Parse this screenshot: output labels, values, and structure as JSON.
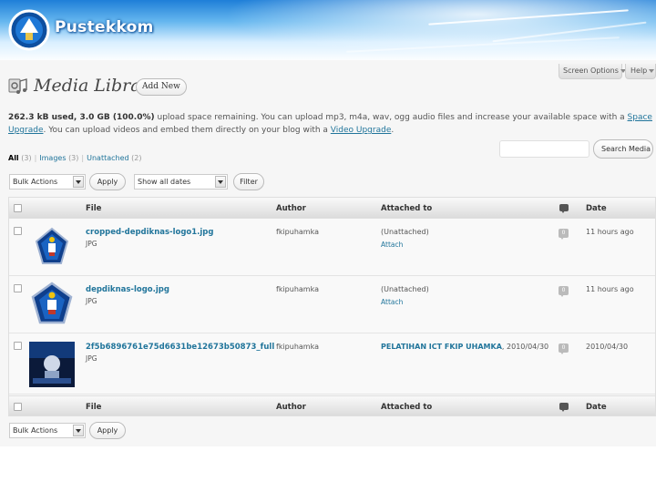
{
  "banner": {
    "title": "Pustekkom"
  },
  "tabs": {
    "screen_options": "Screen Options",
    "help": "Help"
  },
  "page": {
    "title": "Media Library",
    "add_new": "Add New"
  },
  "space_info": {
    "used": "262.3 kB used, 3.0 GB (100.0%)",
    "text1": " upload space remaining. You can upload mp3, m4a, wav, ogg audio files and increase your available space with a ",
    "upgrade_link": "Space Upgrade",
    "text2": ". You can upload videos and embed them directly on your blog with a ",
    "video_link": "Video Upgrade",
    "text3": "."
  },
  "filters": {
    "all": "All",
    "all_count": "(3)",
    "images": "Images",
    "images_count": "(3)",
    "unattached": "Unattached",
    "unattached_count": "(2)"
  },
  "search": {
    "button": "Search Media",
    "value": ""
  },
  "toolbar": {
    "bulk_actions": "Bulk Actions",
    "apply": "Apply",
    "dates": "Show all dates",
    "filter": "Filter"
  },
  "table": {
    "columns": {
      "file": "File",
      "author": "Author",
      "attached": "Attached to",
      "date": "Date"
    },
    "rows": [
      {
        "file": "cropped-depdiknas-logo1.jpg",
        "type": "JPG",
        "author": "fkipuhamka",
        "attached": "(Unattached)",
        "attach_link": "Attach",
        "attached_date": "",
        "comments": "0",
        "date": "11 hours ago"
      },
      {
        "file": "depdiknas-logo.jpg",
        "type": "JPG",
        "author": "fkipuhamka",
        "attached": "(Unattached)",
        "attach_link": "Attach",
        "attached_date": "",
        "comments": "0",
        "date": "11 hours ago"
      },
      {
        "file": "2f5b6896761e75d6631be12673b50873_full",
        "type": "JPG",
        "author": "fkipuhamka",
        "attached": "PELATIHAN ICT FKIP UHAMKA",
        "attach_link": "",
        "attached_date": ", 2010/04/30",
        "comments": "0",
        "date": "2010/04/30"
      }
    ]
  },
  "colors": {
    "link": "#21759b",
    "banner": "#1f7fd8"
  }
}
